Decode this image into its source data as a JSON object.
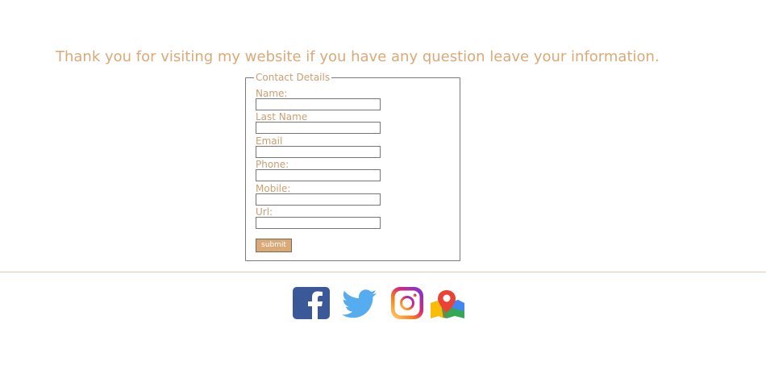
{
  "intro": "Thank you for visiting my website if you have any question leave your information.",
  "form": {
    "legend": "Contact Details",
    "fields": [
      {
        "label": "Name:",
        "value": ""
      },
      {
        "label": "Last Name",
        "value": ""
      },
      {
        "label": "Email",
        "value": ""
      },
      {
        "label": "Phone:",
        "value": ""
      },
      {
        "label": "Mobile:",
        "value": ""
      },
      {
        "label": "Url:",
        "value": ""
      }
    ],
    "submit_label": "submit"
  },
  "social": [
    {
      "name": "facebook-icon",
      "color": "#3b5998"
    },
    {
      "name": "twitter-icon",
      "color": "#55acee"
    },
    {
      "name": "instagram-icon",
      "color": "#e1306c"
    },
    {
      "name": "map-icon",
      "color": "#34a853"
    }
  ],
  "colors": {
    "accent": "#d9aa78",
    "label": "#c9a071",
    "rule": "#e7cdb2"
  }
}
